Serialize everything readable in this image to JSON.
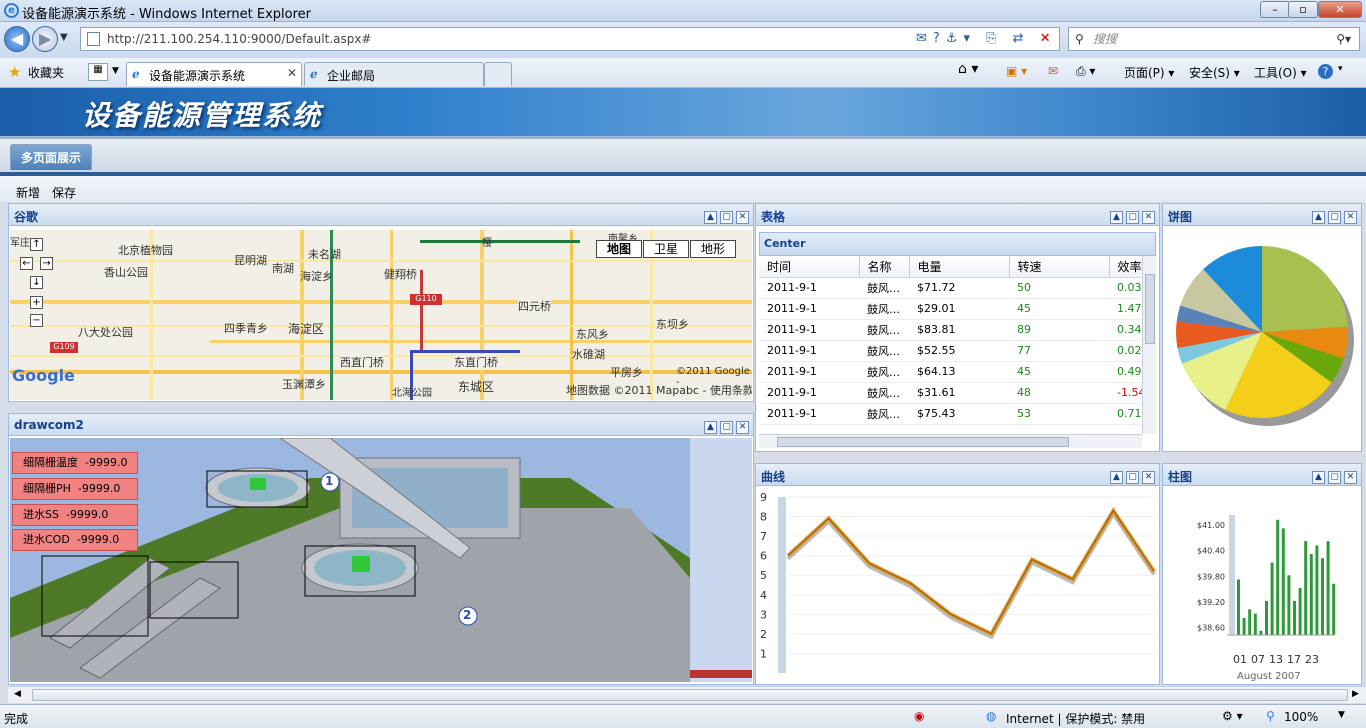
{
  "browser": {
    "window_title": "设备能源演示系统 - Windows Internet Explorer",
    "url": "http://211.100.254.110:9000/Default.aspx#",
    "search_placeholder": "搜搜",
    "favorites": "收藏夹",
    "tabs": [
      {
        "label": "设备能源演示系统"
      },
      {
        "label": "企业邮局"
      }
    ],
    "toolbar": {
      "page": "页面(P)",
      "safety": "安全(S)",
      "tools": "工具(O)"
    },
    "status": {
      "left": "完成",
      "zone": "Internet | 保护模式: 禁用",
      "zoom": "100%"
    }
  },
  "app": {
    "title": "设备能源管理系统",
    "main_tab": "多页面展示",
    "actions": {
      "add": "新增",
      "save": "保存"
    }
  },
  "panels": {
    "map": {
      "title": "谷歌",
      "buttons": [
        "地图",
        "卫星",
        "地形"
      ],
      "labels": [
        "北京植物园",
        "昆明湖",
        "香山公园",
        "南湖",
        "未名湖",
        "海淀乡",
        "健翔桥",
        "四元桥",
        "八大处公园",
        "四季青乡",
        "海淀区",
        "西直门桥",
        "东直门桥",
        "东风乡",
        "东坝乡",
        "水碓湖",
        "玉渊潭乡",
        "北海公园",
        "东城区",
        "平房乡",
        "G110",
        "G109",
        "军庄",
        "樱",
        "南馨乡"
      ],
      "copyright": "©2011 Google -",
      "mapdata": "地图数据 ©2011 Mapabc - 使用条款",
      "logo": "Google"
    },
    "scada": {
      "title": "drawcom2",
      "sensors": [
        {
          "label": "细隔栅温度",
          "value": "-9999.0"
        },
        {
          "label": "细隔栅PH",
          "value": "-9999.0"
        },
        {
          "label": "进水SS",
          "value": "-9999.0"
        },
        {
          "label": "进水COD",
          "value": "-9999.0"
        }
      ],
      "markers": [
        "1",
        "2"
      ]
    },
    "grid": {
      "title": "表格",
      "subtitle": "Center",
      "columns": [
        "时间",
        "名称",
        "电量",
        "转速",
        "效率"
      ],
      "rows": [
        [
          "2011-9-1",
          "鼓风…",
          "$71.72",
          "50",
          "0.03%"
        ],
        [
          "2011-9-1",
          "鼓风…",
          "$29.01",
          "45",
          "1.47%"
        ],
        [
          "2011-9-1",
          "鼓风…",
          "$83.81",
          "89",
          "0.34%"
        ],
        [
          "2011-9-1",
          "鼓风…",
          "$52.55",
          "77",
          "0.02%"
        ],
        [
          "2011-9-1",
          "鼓风…",
          "$64.13",
          "45",
          "0.49%"
        ],
        [
          "2011-9-1",
          "鼓风…",
          "$31.61",
          "48",
          "-1.54"
        ],
        [
          "2011-9-1",
          "鼓风…",
          "$75.43",
          "53",
          "0.71%"
        ]
      ]
    },
    "pie": {
      "title": "饼图"
    },
    "line": {
      "title": "曲线"
    },
    "bar": {
      "title": "柱图"
    }
  },
  "chart_data": [
    {
      "type": "pie",
      "values": [
        24,
        6,
        5,
        22,
        12,
        3,
        5,
        3,
        8,
        12
      ],
      "colors": [
        "#a8c050",
        "#e88a10",
        "#6aa80a",
        "#f4cf1a",
        "#e8f08a",
        "#7ec8e0",
        "#e85a20",
        "#5a82b8",
        "#c8c8a0",
        "#1c8cd8"
      ]
    },
    {
      "type": "line",
      "x": [
        1,
        2,
        3,
        4,
        5,
        6,
        7,
        8,
        9,
        10,
        11,
        12
      ],
      "values": [
        6.0,
        7.9,
        5.6,
        4.6,
        3.0,
        2.0,
        5.8,
        4.8,
        8.3,
        5.2
      ],
      "ylim": [
        0,
        9
      ],
      "yticks": [
        "1",
        "2",
        "3",
        "4",
        "5",
        "6",
        "7",
        "8",
        "9"
      ]
    },
    {
      "type": "bar",
      "yticks": [
        "$41.00",
        "$40.40",
        "$39.80",
        "$39.20",
        "$38.60"
      ],
      "ylim": [
        38.4,
        41.4
      ],
      "values": [
        39.7,
        38.8,
        39.0,
        38.9,
        38.5,
        39.2,
        40.1,
        41.1,
        40.9,
        39.8,
        39.2,
        39.5,
        40.6,
        40.3,
        40.5,
        40.2,
        40.6,
        39.6
      ],
      "xticks": [
        "01",
        "07",
        "13",
        "17",
        "23"
      ],
      "xlabel": "August 2007"
    }
  ]
}
